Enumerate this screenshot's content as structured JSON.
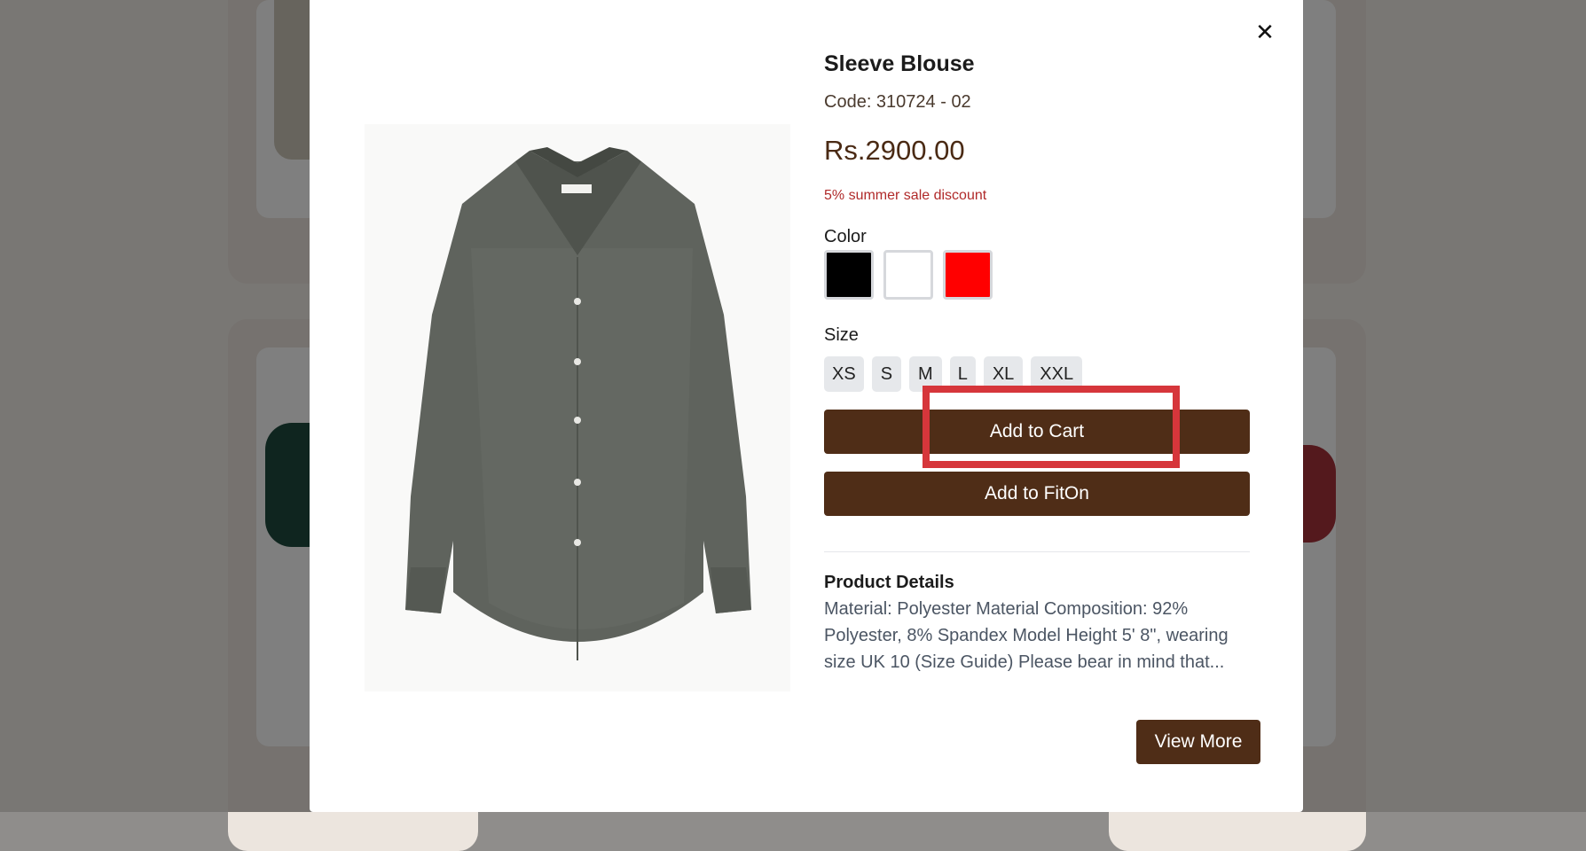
{
  "modal": {
    "close_icon": "close-icon",
    "product_name": "Sleeve Blouse",
    "code": "Code: 310724 - 02",
    "price": "Rs.2900.00",
    "discount": "5% summer sale discount",
    "color_label": "Color",
    "colors": [
      {
        "name": "black",
        "hex": "#000000"
      },
      {
        "name": "white",
        "hex": "#ffffff"
      },
      {
        "name": "red",
        "hex": "#ff0000"
      }
    ],
    "size_label": "Size",
    "sizes": [
      "XS",
      "S",
      "M",
      "L",
      "XL",
      "XXL"
    ],
    "add_to_cart_label": "Add to Cart",
    "add_to_fiton_label": "Add to FitOn",
    "product_details_title": "Product Details",
    "product_details_text": "Material: Polyester Material Composition: 92% Polyester, 8% Spandex Model Height 5' 8\", wearing size UK 10 (Size Guide) Please bear in mind that...",
    "view_more_label": "View More"
  },
  "colors": {
    "brand_brown": "#4f2d17",
    "discount_red": "#b02a2a",
    "highlight_red": "#d6363b",
    "product_image": "dark-grey-shirt"
  }
}
